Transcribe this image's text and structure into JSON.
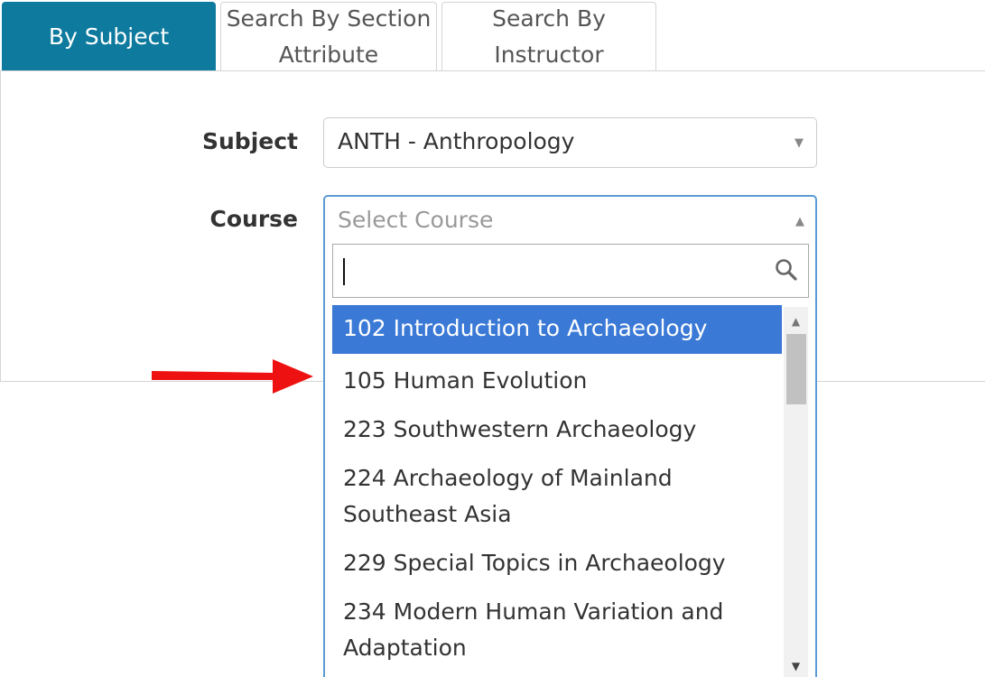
{
  "tabs": [
    {
      "label": "By Subject",
      "active": true
    },
    {
      "label": "Search By Section Attribute",
      "active": false
    },
    {
      "label": "Search By Instructor",
      "active": false
    }
  ],
  "form": {
    "subject_label": "Subject",
    "subject_value": "ANTH - Anthropology",
    "course_label": "Course",
    "course_placeholder": "Select Course"
  },
  "dropdown": {
    "search_value": "",
    "options": [
      "102 Introduction to Archaeology",
      "105 Human Evolution",
      "223 Southwestern Archaeology",
      "224 Archaeology of Mainland Southeast Asia",
      "229 Special Topics in Archaeology",
      "234 Modern Human Variation and Adaptation"
    ],
    "highlighted_index": 0
  },
  "icons": {
    "caret_down": "▼",
    "caret_up": "▲",
    "search": "search-icon",
    "annotation_arrow": "red-arrow-icon"
  },
  "colors": {
    "active_tab": "#0e7a9e",
    "highlight": "#3a79d6",
    "focus_border": "#5b9bd5",
    "annotation_arrow": "#ee1111"
  }
}
